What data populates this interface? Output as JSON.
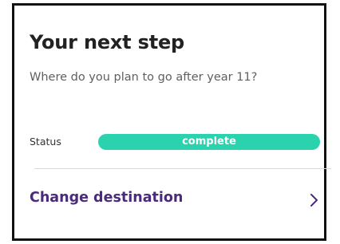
{
  "card": {
    "title": "Your next step",
    "subtitle": "Where do you plan to go after year 11?",
    "status": {
      "label": "Status",
      "value": "complete",
      "progress": 1.0,
      "color": "#2ad3ad"
    },
    "action": {
      "label": "Change destination",
      "icon": "chevron-right-icon",
      "color": "#4a2b7a"
    }
  }
}
